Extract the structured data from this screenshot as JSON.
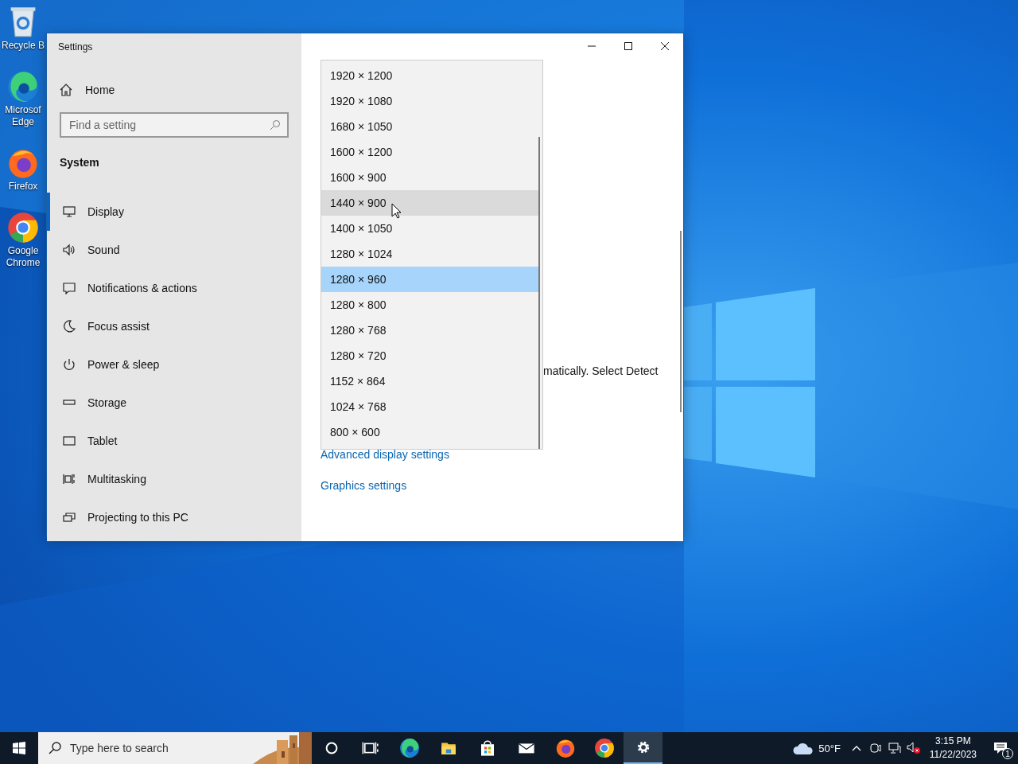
{
  "desktop_icons": [
    {
      "kind": "recycle-bin",
      "label": "Recycle B"
    },
    {
      "kind": "edge",
      "label": "Microsof Edge"
    },
    {
      "kind": "firefox",
      "label": "Firefox"
    },
    {
      "kind": "chrome",
      "label": "Google Chrome"
    }
  ],
  "window": {
    "title": "Settings",
    "home": "Home",
    "search": {
      "placeholder": "Find a setting"
    },
    "section": "System",
    "nav": [
      {
        "kind": "display",
        "label": "Display",
        "selected": true
      },
      {
        "kind": "sound",
        "label": "Sound",
        "selected": false
      },
      {
        "kind": "notifications",
        "label": "Notifications & actions",
        "selected": false
      },
      {
        "kind": "focus",
        "label": "Focus assist",
        "selected": false
      },
      {
        "kind": "power",
        "label": "Power & sleep",
        "selected": false
      },
      {
        "kind": "storage",
        "label": "Storage",
        "selected": false
      },
      {
        "kind": "tablet",
        "label": "Tablet",
        "selected": false
      },
      {
        "kind": "multitasking",
        "label": "Multitasking",
        "selected": false
      },
      {
        "kind": "projecting",
        "label": "Projecting to this PC",
        "selected": false
      }
    ],
    "content": {
      "text_fragment": "matically. Select Detect",
      "links": [
        "Advanced display settings",
        "Graphics settings"
      ]
    },
    "resolution_list": [
      {
        "label": "1920 × 1200",
        "selected": false,
        "hovered": false
      },
      {
        "label": "1920 × 1080",
        "selected": false,
        "hovered": false
      },
      {
        "label": "1680 × 1050",
        "selected": false,
        "hovered": false
      },
      {
        "label": "1600 × 1200",
        "selected": false,
        "hovered": false
      },
      {
        "label": "1600 × 900",
        "selected": false,
        "hovered": false
      },
      {
        "label": "1440 × 900",
        "selected": false,
        "hovered": true
      },
      {
        "label": "1400 × 1050",
        "selected": false,
        "hovered": false
      },
      {
        "label": "1280 × 1024",
        "selected": false,
        "hovered": false
      },
      {
        "label": "1280 × 960",
        "selected": true,
        "hovered": false
      },
      {
        "label": "1280 × 800",
        "selected": false,
        "hovered": false
      },
      {
        "label": "1280 × 768",
        "selected": false,
        "hovered": false
      },
      {
        "label": "1280 × 720",
        "selected": false,
        "hovered": false
      },
      {
        "label": "1152 × 864",
        "selected": false,
        "hovered": false
      },
      {
        "label": "1024 × 768",
        "selected": false,
        "hovered": false
      },
      {
        "label": "800 × 600",
        "selected": false,
        "hovered": false
      }
    ]
  },
  "taskbar": {
    "search": {
      "placeholder": "Type here to search"
    },
    "apps": [
      {
        "kind": "cortana",
        "active": false
      },
      {
        "kind": "task-view",
        "active": false
      },
      {
        "kind": "edge",
        "active": false
      },
      {
        "kind": "explorer",
        "active": false
      },
      {
        "kind": "store",
        "active": false
      },
      {
        "kind": "mail",
        "active": false
      },
      {
        "kind": "firefox",
        "active": false
      },
      {
        "kind": "chrome",
        "active": false
      },
      {
        "kind": "settings",
        "active": true
      }
    ],
    "weather": "50°F",
    "time": "3:15 PM",
    "date": "11/22/2023",
    "notification_count": "1"
  }
}
